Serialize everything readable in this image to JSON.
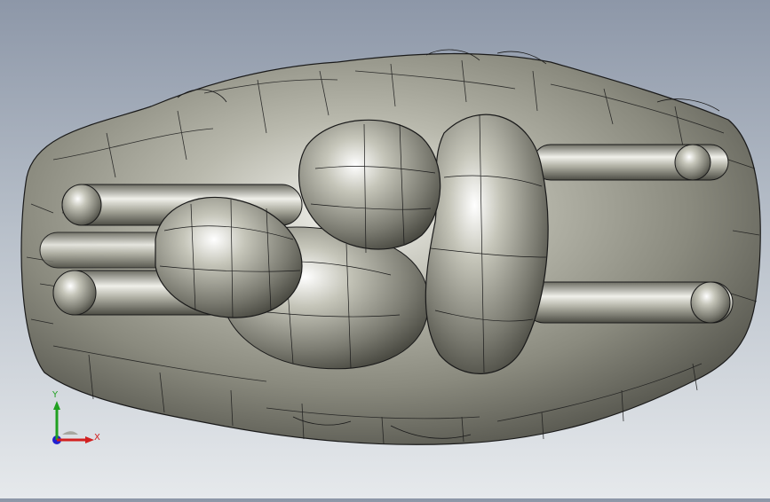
{
  "viewport": {
    "background_top": "#8d97a8",
    "background_bottom": "#e6e9ec",
    "model_color": "#9a9a8e",
    "edge_color": "#1a1a1a"
  },
  "triad": {
    "x_label": "X",
    "y_label": "Y",
    "x_color": "#d22020",
    "y_color": "#20a020",
    "z_color": "#2020d0"
  }
}
